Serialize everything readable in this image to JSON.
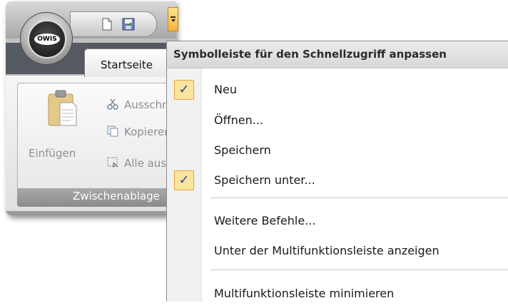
{
  "app": {
    "logo_text": "OWIS",
    "tab_label": "Startseite",
    "clipboard_group": {
      "paste_label": "Einfügen",
      "cut_label": "Ausschneiden",
      "copy_label": "Kopieren",
      "select_all_label": "Alle auswählen",
      "group_label": "Zwischenablage"
    },
    "qat_icons": [
      "new-document-icon",
      "save-icon",
      "qat-dropdown-icon"
    ]
  },
  "menu": {
    "title": "Symbolleiste für den Schnellzugriff anpassen",
    "items": [
      {
        "label": "Neu",
        "checked": true
      },
      {
        "label": "Öffnen...",
        "checked": false
      },
      {
        "label": "Speichern",
        "checked": false
      },
      {
        "label": "Speichern unter...",
        "checked": true
      },
      {
        "label": "Weitere Befehle...",
        "checked": false
      },
      {
        "label": "Unter der Multifunktionsleiste anzeigen",
        "checked": false
      },
      {
        "label": "Multifunktionsleiste minimieren",
        "checked": false
      }
    ],
    "check_glyph": "✓"
  },
  "colors": {
    "check_bg": "#fde49d",
    "check_border": "#e7a43c",
    "check_mark": "#1f4a9e",
    "tab_bar": "#555a62"
  }
}
